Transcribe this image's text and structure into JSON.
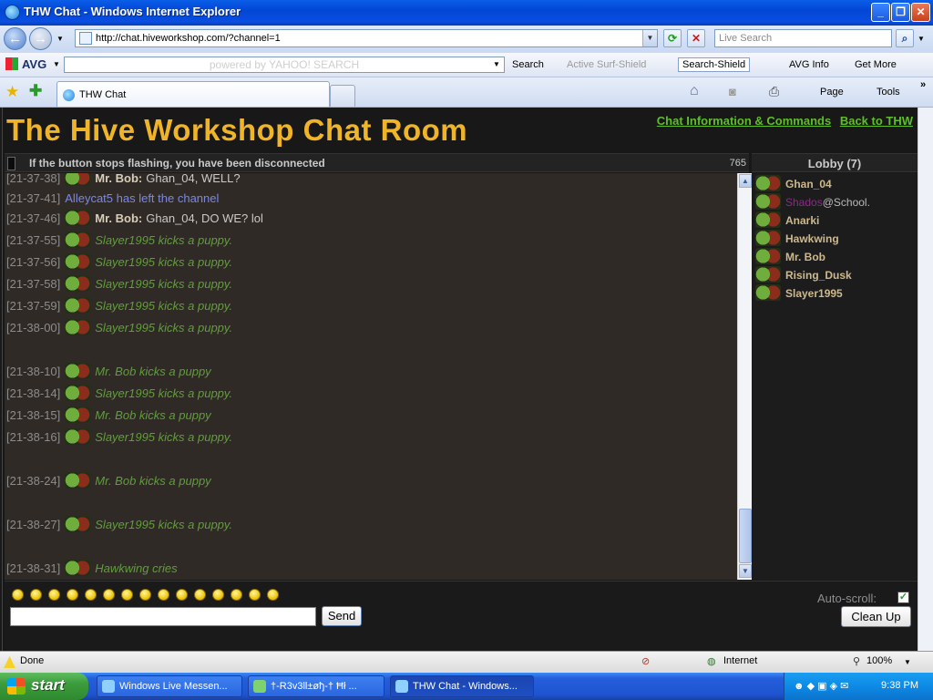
{
  "window": {
    "title": "THW Chat - Windows Internet Explorer"
  },
  "addressbar": {
    "url": "http://chat.hiveworkshop.com/?channel=1",
    "search_placeholder": "Live Search"
  },
  "avg_toolbar": {
    "brand": "AVG",
    "search_placeholder": "powered by YAHOO! SEARCH",
    "search_label": "Search",
    "active_surf": "Active  Surf-Shield",
    "search_shield": "Search-Shield",
    "avg_info": "AVG Info",
    "get_more": "Get More"
  },
  "tabs": {
    "active_label": "THW Chat"
  },
  "command_bar": {
    "page_label": "Page",
    "tools_label": "Tools"
  },
  "page": {
    "title": "The Hive Workshop Chat Room",
    "links": [
      "Chat Information & Commands",
      "Back to THW"
    ],
    "status_message": "If the button stops flashing, you have been disconnected",
    "counter": "765",
    "lobby_header": "Lobby (7)"
  },
  "messages": [
    {
      "ts": "[21-37-38]",
      "kind": "say",
      "name": "Mr. Bob:",
      "text": "Ghan_04, WELL?"
    },
    {
      "ts": "[21-37-41]",
      "kind": "system",
      "text": "Alleycat5 has left the channel"
    },
    {
      "ts": "[21-37-46]",
      "kind": "say",
      "name": "Mr. Bob:",
      "text": "Ghan_04, DO WE? lol"
    },
    {
      "ts": "[21-37-55]",
      "kind": "action",
      "text": "Slayer1995 kicks a puppy."
    },
    {
      "ts": "[21-37-56]",
      "kind": "action",
      "text": "Slayer1995 kicks a puppy."
    },
    {
      "ts": "[21-37-58]",
      "kind": "action",
      "text": "Slayer1995 kicks a puppy."
    },
    {
      "ts": "[21-37-59]",
      "kind": "action",
      "text": "Slayer1995 kicks a puppy."
    },
    {
      "ts": "[21-38-00]",
      "kind": "action",
      "text": "Slayer1995 kicks a puppy."
    },
    {
      "ts": "[21-38-10]",
      "kind": "action",
      "text": "Mr. Bob kicks a puppy"
    },
    {
      "ts": "[21-38-14]",
      "kind": "action",
      "text": "Slayer1995 kicks a puppy."
    },
    {
      "ts": "[21-38-15]",
      "kind": "action",
      "text": "Mr. Bob kicks a puppy"
    },
    {
      "ts": "[21-38-16]",
      "kind": "action",
      "text": "Slayer1995 kicks a puppy."
    },
    {
      "ts": "[21-38-24]",
      "kind": "action",
      "text": "Mr. Bob kicks a puppy"
    },
    {
      "ts": "[21-38-27]",
      "kind": "action",
      "text": "Slayer1995 kicks a puppy."
    },
    {
      "ts": "[21-38-31]",
      "kind": "action",
      "text": "Hawkwing cries"
    }
  ],
  "lobby": [
    {
      "name": "Ghan_04"
    },
    {
      "name_purple": "Shados",
      "name_rest": "@School."
    },
    {
      "name": "Anarki"
    },
    {
      "name": "Hawkwing"
    },
    {
      "name": "Mr. Bob"
    },
    {
      "name": "Rising_Dusk"
    },
    {
      "name": "Slayer1995"
    }
  ],
  "composer": {
    "send_label": "Send",
    "autoscroll_label": "Auto-scroll:",
    "autoscroll_checked": true,
    "cleanup_label": "Clean Up",
    "smiley_count": 15
  },
  "ie_status": {
    "text": "Done",
    "zone": "Internet",
    "zoom": "100%"
  },
  "taskbar": {
    "start_label": "start",
    "tasks": [
      "Windows Live Messen...",
      "†-R3v3ll±øђ-† Ħł ...",
      "THW Chat - Windows..."
    ],
    "clock": "9:38 PM"
  },
  "colors": {
    "title_gold": "#f0b429",
    "link_green": "#5fbf2a",
    "action_green": "#5f9e3a",
    "system_blue": "#7a88e0"
  }
}
